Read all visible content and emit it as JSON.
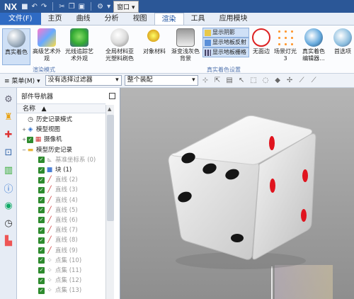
{
  "title_bar": {
    "app": "NX",
    "window_menu": "窗口"
  },
  "tabs": [
    {
      "label": "文件(F)",
      "kind": "file"
    },
    {
      "label": "主页"
    },
    {
      "label": "曲线"
    },
    {
      "label": "分析"
    },
    {
      "label": "视图"
    },
    {
      "label": "渲染",
      "active": true
    },
    {
      "label": "工具"
    },
    {
      "label": "应用模块"
    }
  ],
  "ribbon": {
    "groups": [
      "渲染模式",
      "真实着色设置"
    ],
    "buttons": {
      "true_shading": "真实着色",
      "advanced_studio": "高级艺术外观",
      "raytrace_studio": "光线追踪艺术外观",
      "global_material": "全局材料亚光塑料刷色",
      "object_material": "对象材料",
      "gradient_bg": "渐变浅灰色背景",
      "no_edge": "无面边",
      "scene_light": "场景灯光 3",
      "true_shading_editor": "真实着色编辑器...",
      "preferences": "首选项"
    },
    "small_stack": [
      "显示阴影",
      "显示地板反射",
      "显示地板栅格"
    ]
  },
  "toolbar": {
    "menu": "菜单(M)",
    "filter": "没有选择过滤器",
    "assembly": "整个装配"
  },
  "navigator": {
    "title": "部件导航器",
    "column": "名称",
    "rows": [
      {
        "exp": "",
        "chk": false,
        "icon": "history-icon",
        "label": "历史记录模式",
        "dim": false
      },
      {
        "exp": "+",
        "chk": false,
        "icon": "model-view-icon",
        "label": "模型视图",
        "dim": false
      },
      {
        "exp": "+",
        "chk": true,
        "icon": "camera-icon",
        "label": "摄像机",
        "dim": false
      },
      {
        "exp": "−",
        "chk": false,
        "icon": "folder-icon",
        "label": "模型历史记录",
        "dim": false
      },
      {
        "exp": "",
        "chk": true,
        "icon": "datum-csys-icon",
        "label": "基准坐标系 (0)",
        "dim": true
      },
      {
        "exp": "",
        "chk": true,
        "icon": "block-icon",
        "label": "块 (1)",
        "dim": false
      },
      {
        "exp": "",
        "chk": true,
        "icon": "line-icon",
        "label": "直线 (2)",
        "dim": true
      },
      {
        "exp": "",
        "chk": true,
        "icon": "line-icon",
        "label": "直线 (3)",
        "dim": true
      },
      {
        "exp": "",
        "chk": true,
        "icon": "line-icon",
        "label": "直线 (4)",
        "dim": true
      },
      {
        "exp": "",
        "chk": true,
        "icon": "line-icon",
        "label": "直线 (5)",
        "dim": true
      },
      {
        "exp": "",
        "chk": true,
        "icon": "line-icon",
        "label": "直线 (6)",
        "dim": true
      },
      {
        "exp": "",
        "chk": true,
        "icon": "line-icon",
        "label": "直线 (7)",
        "dim": true
      },
      {
        "exp": "",
        "chk": true,
        "icon": "line-icon",
        "label": "直线 (8)",
        "dim": true
      },
      {
        "exp": "",
        "chk": true,
        "icon": "line-icon",
        "label": "直线 (9)",
        "dim": true
      },
      {
        "exp": "",
        "chk": true,
        "icon": "point-set-icon",
        "label": "点集 (10)",
        "dim": true
      },
      {
        "exp": "",
        "chk": true,
        "icon": "point-set-icon",
        "label": "点集 (11)",
        "dim": true
      },
      {
        "exp": "",
        "chk": true,
        "icon": "point-set-icon",
        "label": "点集 (12)",
        "dim": true
      },
      {
        "exp": "",
        "chk": true,
        "icon": "point-set-icon",
        "label": "点集 (13)",
        "dim": true
      }
    ]
  },
  "colors": {
    "accent": "#2b5797",
    "die_pip_black": "#151515",
    "die_pip_red": "#e0141e"
  }
}
